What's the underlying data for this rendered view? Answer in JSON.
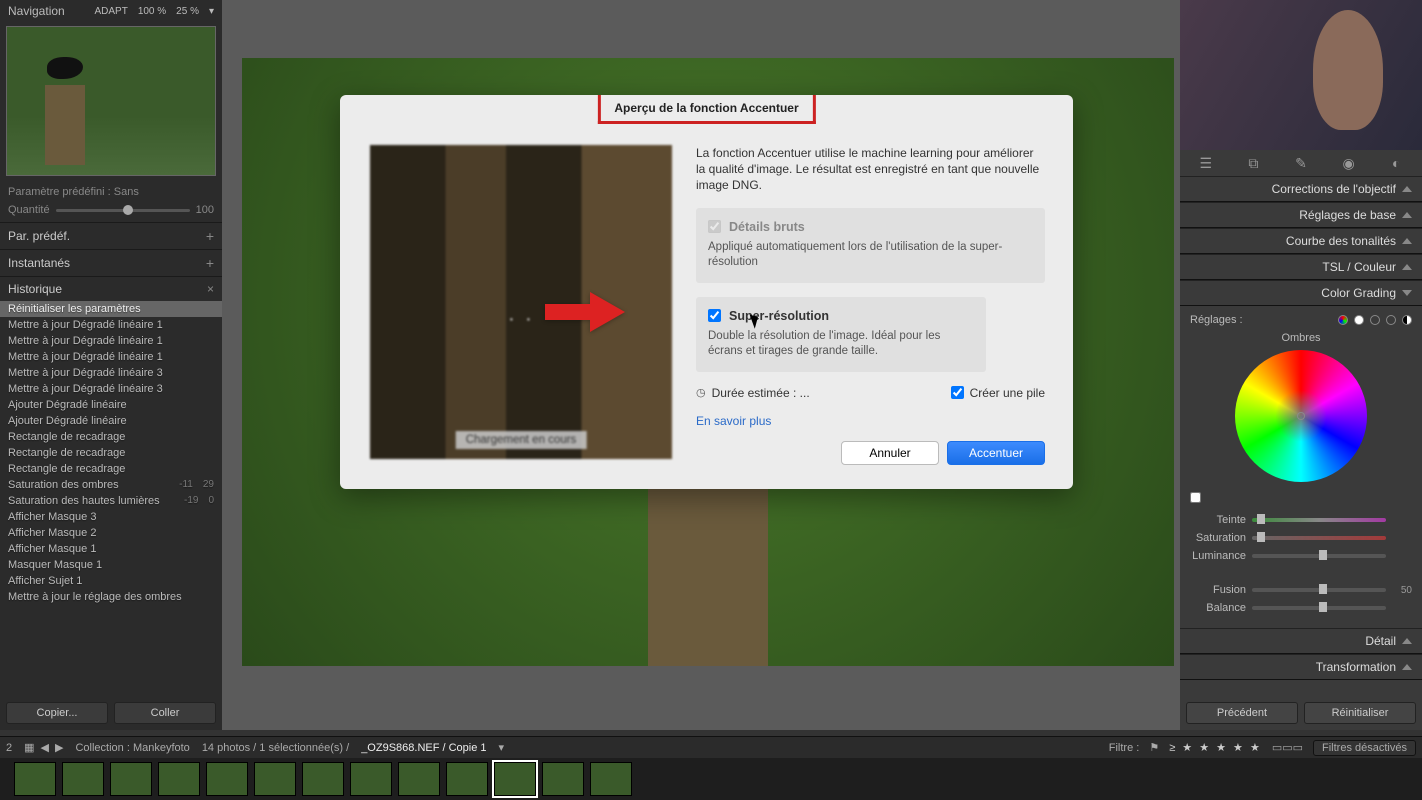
{
  "leftPanel": {
    "nav_title": "Navigation",
    "adapt_label": "ADAPT",
    "zoom1": "100 %",
    "zoom2": "25 %",
    "preset_label": "Paramètre prédéfini :",
    "preset_value": "Sans",
    "quantity_label": "Quantité",
    "quantity_value": "100",
    "par_defaut": "Par. prédéf.",
    "instantanes": "Instantanés",
    "historique": "Historique",
    "history": [
      {
        "label": "Réinitialiser les paramètres",
        "sel": true
      },
      {
        "label": "Mettre à jour Dégradé linéaire 1"
      },
      {
        "label": "Mettre à jour Dégradé linéaire 1"
      },
      {
        "label": "Mettre à jour Dégradé linéaire 1"
      },
      {
        "label": "Mettre à jour Dégradé linéaire 3"
      },
      {
        "label": "Mettre à jour Dégradé linéaire 3"
      },
      {
        "label": "Ajouter Dégradé linéaire"
      },
      {
        "label": "Ajouter Dégradé linéaire"
      },
      {
        "label": "Rectangle de recadrage"
      },
      {
        "label": "Rectangle de recadrage"
      },
      {
        "label": "Rectangle de recadrage"
      },
      {
        "label": "Saturation des ombres",
        "v1": "-11",
        "v2": "29"
      },
      {
        "label": "Saturation des hautes lumières",
        "v1": "-19",
        "v2": "0"
      },
      {
        "label": "Afficher Masque 3"
      },
      {
        "label": "Afficher Masque 2"
      },
      {
        "label": "Afficher Masque 1"
      },
      {
        "label": "Masquer Masque 1"
      },
      {
        "label": "Afficher Sujet 1"
      },
      {
        "label": "Mettre à jour le réglage des ombres"
      }
    ],
    "copy_btn": "Copier...",
    "paste_btn": "Coller"
  },
  "modal": {
    "title": "Aperçu de la fonction Accentuer",
    "loading": "Chargement en cours",
    "description": "La fonction Accentuer utilise le machine learning pour améliorer la qualité d'image. Le résultat est enregistré en tant que nouvelle image DNG.",
    "opt1_label": "Détails bruts",
    "opt1_sub": "Appliqué automatiquement lors de l'utilisation de la super-résolution",
    "opt2_label": "Super-résolution",
    "opt2_sub": "Double la résolution de l'image. Idéal pour les écrans et tirages de grande taille.",
    "duration_label": "Durée estimée : ...",
    "stack_label": "Créer une pile",
    "learn_more": "En savoir plus",
    "cancel_btn": "Annuler",
    "ok_btn": "Accentuer"
  },
  "rightPanel": {
    "sections": {
      "lens": "Corrections de l'objectif",
      "basic": "Réglages de base",
      "curve": "Courbe des tonalités",
      "tsl": "TSL / Couleur",
      "grading": "Color Grading",
      "detail": "Détail",
      "transform": "Transformation"
    },
    "grading": {
      "reglages": "Réglages :",
      "ombres": "Ombres",
      "teinte": "Teinte",
      "saturation": "Saturation",
      "luminance": "Luminance",
      "fusion": "Fusion",
      "fusion_val": "50",
      "balance": "Balance"
    },
    "prev_btn": "Précédent",
    "reset_btn": "Réinitialiser"
  },
  "infoBar": {
    "page": "2",
    "collection_label": "Collection : Mankeyfoto",
    "count": "14 photos / 1 sélectionnée(s) /",
    "filename": "_OZ9S868.NEF / Copie 1",
    "filter_label": "Filtre :",
    "filter_off": "Filtres désactivés"
  }
}
